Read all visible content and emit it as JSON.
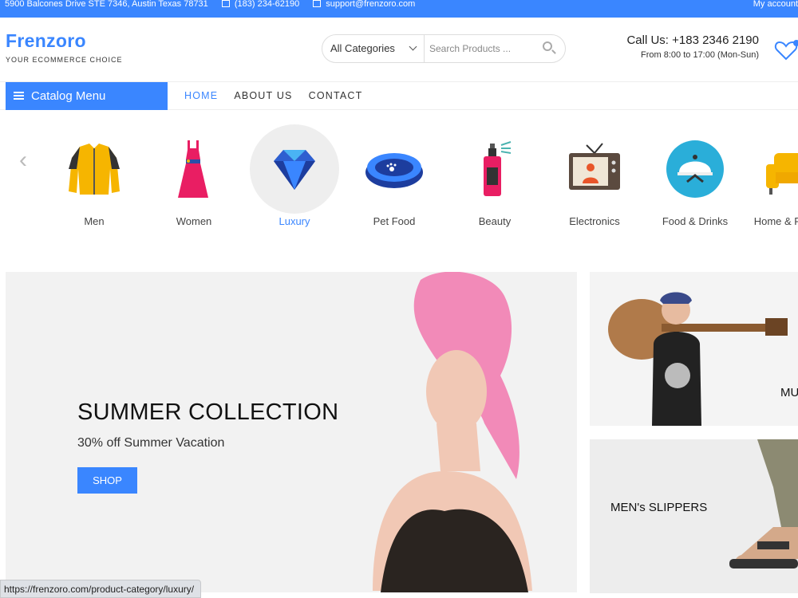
{
  "topbar": {
    "address": "5900 Balcones Drive STE 7346, Austin Texas 78731",
    "phone": "(183) 234-62190",
    "email": "support@frenzoro.com",
    "account": "My account"
  },
  "brand": {
    "name": "Frenzoro",
    "tagline": "YOUR ECOMMERCE CHOICE"
  },
  "search": {
    "category": "All Categories",
    "placeholder": "Search Products ..."
  },
  "contact": {
    "call": "Call Us: +183 2346 2190",
    "hours": "From 8:00 to 17:00 (Mon-Sun)"
  },
  "nav": {
    "catalog": "Catalog Menu",
    "links": [
      "HOME",
      "ABOUT US",
      "CONTACT"
    ]
  },
  "categories": [
    {
      "label": "Men",
      "icon": "jacket-icon"
    },
    {
      "label": "Women",
      "icon": "dress-icon"
    },
    {
      "label": "Luxury",
      "icon": "diamond-icon",
      "selected": true
    },
    {
      "label": "Pet Food",
      "icon": "pet-bowl-icon"
    },
    {
      "label": "Beauty",
      "icon": "perfume-icon"
    },
    {
      "label": "Electronics",
      "icon": "tv-icon"
    },
    {
      "label": "Food & Drinks",
      "icon": "cloche-icon"
    },
    {
      "label": "Home & Furniture",
      "icon": "sofa-icon"
    }
  ],
  "hero": {
    "title": "SUMMER COLLECTION",
    "subtitle": "30% off Summer Vacation",
    "button": "SHOP"
  },
  "promos": {
    "music": "MUSIC",
    "slippers": "MEN's SLIPPERS"
  },
  "status_url": "https://frenzoro.com/product-category/luxury/",
  "colors": {
    "accent": "#3a86ff"
  }
}
